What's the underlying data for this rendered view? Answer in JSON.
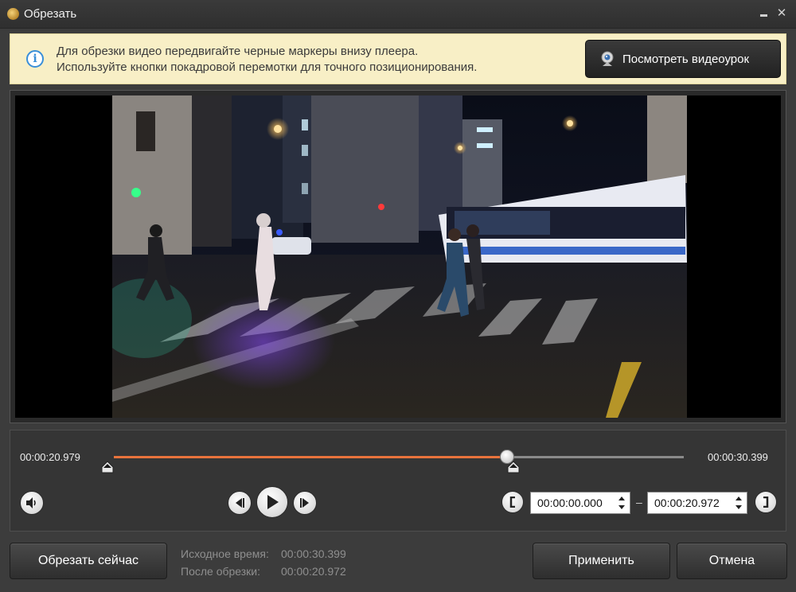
{
  "window": {
    "title": "Обрезать",
    "minimize_icon": "minimize-icon",
    "close_symbol": "✕"
  },
  "banner": {
    "line1": "Для обрезки видео передвигайте черные маркеры внизу плеера.",
    "line2": "Используйте кнопки покадровой перемотки для точного позиционирования.",
    "info_symbol": "i",
    "lesson_button": "Посмотреть видеоурок",
    "background_color": "#f8efc6"
  },
  "timeline": {
    "current_time": "00:00:20.979",
    "total_time": "00:00:30.399",
    "playhead_fraction": 0.69,
    "trim_start_fraction": 0.0,
    "trim_end_fraction": 0.69,
    "accent_color": "#e8733c"
  },
  "trim": {
    "start": "00:00:00.000",
    "end": "00:00:20.972",
    "separator": "–"
  },
  "footer": {
    "cut_now": "Обрезать сейчас",
    "original_label": "Исходное время:",
    "original_value": "00:00:30.399",
    "after_label": "После обрезки:",
    "after_value": "00:00:20.972",
    "apply": "Применить",
    "cancel": "Отмена"
  }
}
